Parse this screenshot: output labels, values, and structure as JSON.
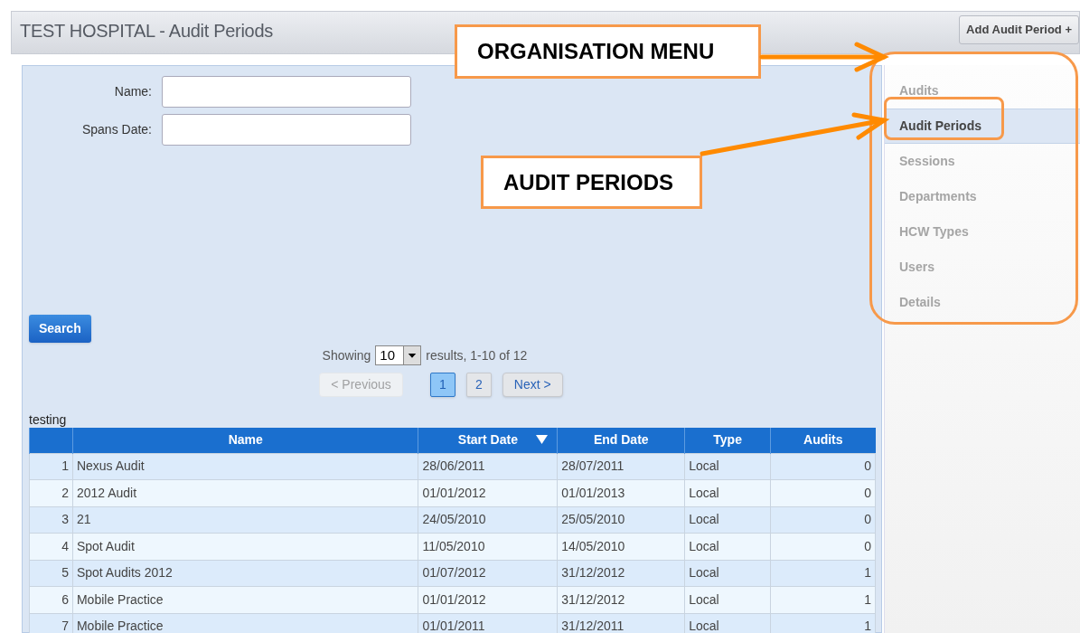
{
  "header": {
    "title": "TEST HOSPITAL - Audit Periods",
    "add_button": "Add Audit Period +"
  },
  "form": {
    "fields": [
      {
        "label": "Name:"
      },
      {
        "label": "Spans Date:"
      }
    ],
    "search_button": "Search"
  },
  "paging": {
    "showing_label": "Showing",
    "page_size": "10",
    "results_text": "results, 1-10 of 12",
    "buttons": [
      {
        "label": "< Previous",
        "kind": "nav",
        "disabled": true,
        "selected": false
      },
      {
        "label": "1",
        "kind": "page",
        "disabled": false,
        "selected": true
      },
      {
        "label": "2",
        "kind": "page",
        "disabled": false,
        "selected": false
      },
      {
        "label": "Next >",
        "kind": "nav",
        "disabled": false,
        "selected": false
      }
    ]
  },
  "table": {
    "caption": "testing",
    "columns": [
      {
        "sorted": false
      },
      {
        "label": "Name",
        "sorted": false
      },
      {
        "label": "Start Date",
        "sorted": true
      },
      {
        "label": "End Date",
        "sorted": false
      },
      {
        "label": "Type",
        "sorted": false
      },
      {
        "label": "Audits",
        "sorted": false
      }
    ],
    "rows": [
      [
        "1",
        "Nexus Audit",
        "28/06/2011",
        "28/07/2011",
        "Local",
        "0"
      ],
      [
        "2",
        "2012 Audit",
        "01/01/2012",
        "01/01/2013",
        "Local",
        "0"
      ],
      [
        "3",
        "21",
        "24/05/2010",
        "25/05/2010",
        "Local",
        "0"
      ],
      [
        "4",
        "Spot Audit",
        "11/05/2010",
        "14/05/2010",
        "Local",
        "0"
      ],
      [
        "5",
        "Spot Audits 2012",
        "01/07/2012",
        "31/12/2012",
        "Local",
        "1"
      ],
      [
        "6",
        "Mobile Practice",
        "01/01/2012",
        "31/12/2012",
        "Local",
        "1"
      ],
      [
        "7",
        "Mobile Practice",
        "01/01/2011",
        "31/12/2011",
        "Local",
        "1"
      ]
    ]
  },
  "sidebar": {
    "items": [
      {
        "label": "Audits",
        "selected": false
      },
      {
        "label": "Audit Periods",
        "selected": true
      },
      {
        "label": "Sessions",
        "selected": false
      },
      {
        "label": "Departments",
        "selected": false
      },
      {
        "label": "HCW Types",
        "selected": false
      },
      {
        "label": "Users",
        "selected": false
      },
      {
        "label": "Details",
        "selected": false
      }
    ]
  },
  "annotations": [
    {
      "text": "ORGANISATION MENU"
    },
    {
      "text": "AUDIT PERIODS"
    }
  ]
}
